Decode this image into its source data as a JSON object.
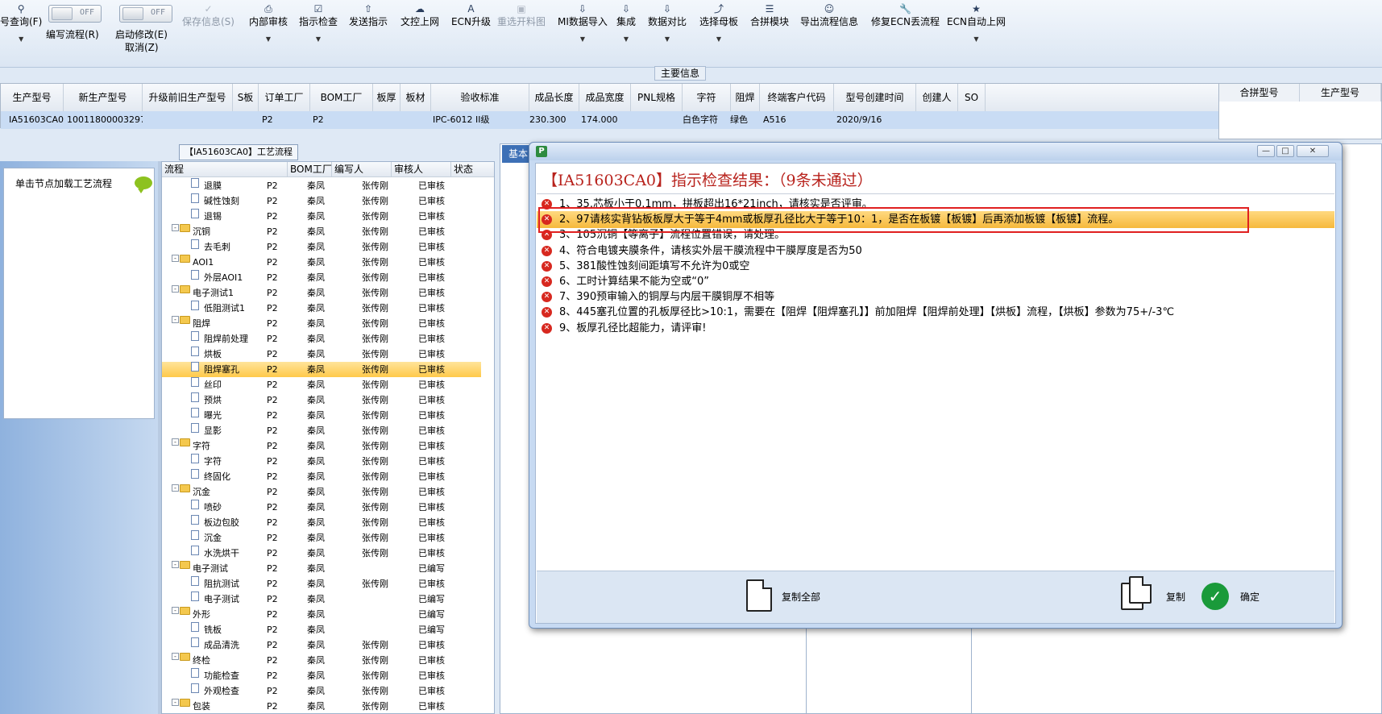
{
  "toolbar": {
    "query_label": "号查询(F)",
    "toggle1_state": "OFF",
    "toggle1_label": "编写流程(R)",
    "toggle2_state": "OFF",
    "toggle2_label": "启动修改(E)",
    "toggle2_sub": "取消(Z)",
    "items": [
      {
        "label": "保存信息(S)"
      },
      {
        "label": "内部审核"
      },
      {
        "label": "指示检查"
      },
      {
        "label": "发送指示"
      },
      {
        "label": "文控上网"
      },
      {
        "label": "ECN升级"
      },
      {
        "label": "重选开料图"
      },
      {
        "label": "MI数据导入"
      },
      {
        "label": "集成"
      },
      {
        "label": "数据对比"
      },
      {
        "label": "选择母板"
      },
      {
        "label": "合拼模块"
      },
      {
        "label": "导出流程信息"
      },
      {
        "label": "修复ECN丢流程"
      },
      {
        "label": "ECN自动上网"
      }
    ]
  },
  "section_label": "主要信息",
  "main_grid": {
    "headers": [
      "生产型号",
      "新生产型号",
      "升级前旧生产型号",
      "S板",
      "订单工厂",
      "BOM工厂",
      "板厚",
      "板材",
      "验收标准",
      "成品长度",
      "成品宽度",
      "PNL规格",
      "字符",
      "阻焊",
      "终端客户代码",
      "型号创建时间",
      "创建人",
      "SO"
    ],
    "row": [
      "IA51603CA0",
      "10011800003297",
      "",
      "",
      "P2",
      "P2",
      "",
      "",
      "IPC-6012 II级",
      "230.300",
      "174.000",
      "",
      "白色字符",
      "绿色",
      "A516",
      "2020/9/16",
      "",
      ""
    ]
  },
  "right_grid": {
    "headers": [
      "合拼型号",
      "生产型号"
    ]
  },
  "process_title": "【IA51603CA0】工艺流程",
  "left_panel": {
    "text": "单击节点加载工艺流程"
  },
  "tree": {
    "headers": [
      "流程",
      "BOM工厂",
      "编写人",
      "审核人",
      "状态"
    ],
    "rows": [
      {
        "name": "退膜",
        "type": "doc",
        "bom": "P2",
        "writer": "秦凤",
        "reviewer": "张传刚",
        "status": "已审核"
      },
      {
        "name": "碱性蚀刻",
        "type": "doc",
        "bom": "P2",
        "writer": "秦凤",
        "reviewer": "张传刚",
        "status": "已审核"
      },
      {
        "name": "退锡",
        "type": "doc",
        "bom": "P2",
        "writer": "秦凤",
        "reviewer": "张传刚",
        "status": "已审核"
      },
      {
        "name": "沉铜",
        "type": "folder",
        "bom": "P2",
        "writer": "秦凤",
        "reviewer": "张传刚",
        "status": "已审核"
      },
      {
        "name": "去毛刺",
        "type": "doc",
        "bom": "P2",
        "writer": "秦凤",
        "reviewer": "张传刚",
        "status": "已审核"
      },
      {
        "name": "AOI1",
        "type": "folder",
        "bom": "P2",
        "writer": "秦凤",
        "reviewer": "张传刚",
        "status": "已审核"
      },
      {
        "name": "外层AOI1",
        "type": "doc",
        "bom": "P2",
        "writer": "秦凤",
        "reviewer": "张传刚",
        "status": "已审核"
      },
      {
        "name": "电子测试1",
        "type": "folder",
        "bom": "P2",
        "writer": "秦凤",
        "reviewer": "张传刚",
        "status": "已审核"
      },
      {
        "name": "低阻测试1",
        "type": "doc",
        "bom": "P2",
        "writer": "秦凤",
        "reviewer": "张传刚",
        "status": "已审核"
      },
      {
        "name": "阻焊",
        "type": "folder",
        "bom": "P2",
        "writer": "秦凤",
        "reviewer": "张传刚",
        "status": "已审核"
      },
      {
        "name": "阻焊前处理",
        "type": "doc",
        "bom": "P2",
        "writer": "秦凤",
        "reviewer": "张传刚",
        "status": "已审核"
      },
      {
        "name": "烘板",
        "type": "doc",
        "bom": "P2",
        "writer": "秦凤",
        "reviewer": "张传刚",
        "status": "已审核"
      },
      {
        "name": "阻焊塞孔",
        "type": "doc",
        "bom": "P2",
        "writer": "秦凤",
        "reviewer": "张传刚",
        "status": "已审核",
        "selected": true
      },
      {
        "name": "丝印",
        "type": "doc",
        "bom": "P2",
        "writer": "秦凤",
        "reviewer": "张传刚",
        "status": "已审核"
      },
      {
        "name": "预烘",
        "type": "doc",
        "bom": "P2",
        "writer": "秦凤",
        "reviewer": "张传刚",
        "status": "已审核"
      },
      {
        "name": "曝光",
        "type": "doc",
        "bom": "P2",
        "writer": "秦凤",
        "reviewer": "张传刚",
        "status": "已审核"
      },
      {
        "name": "显影",
        "type": "doc",
        "bom": "P2",
        "writer": "秦凤",
        "reviewer": "张传刚",
        "status": "已审核"
      },
      {
        "name": "字符",
        "type": "folder",
        "bom": "P2",
        "writer": "秦凤",
        "reviewer": "张传刚",
        "status": "已审核"
      },
      {
        "name": "字符",
        "type": "doc",
        "bom": "P2",
        "writer": "秦凤",
        "reviewer": "张传刚",
        "status": "已审核"
      },
      {
        "name": "终固化",
        "type": "doc",
        "bom": "P2",
        "writer": "秦凤",
        "reviewer": "张传刚",
        "status": "已审核"
      },
      {
        "name": "沉金",
        "type": "folder",
        "bom": "P2",
        "writer": "秦凤",
        "reviewer": "张传刚",
        "status": "已审核"
      },
      {
        "name": "喷砂",
        "type": "doc",
        "bom": "P2",
        "writer": "秦凤",
        "reviewer": "张传刚",
        "status": "已审核"
      },
      {
        "name": "板边包胶",
        "type": "doc",
        "bom": "P2",
        "writer": "秦凤",
        "reviewer": "张传刚",
        "status": "已审核"
      },
      {
        "name": "沉金",
        "type": "doc",
        "bom": "P2",
        "writer": "秦凤",
        "reviewer": "张传刚",
        "status": "已审核"
      },
      {
        "name": "水洗烘干",
        "type": "doc",
        "bom": "P2",
        "writer": "秦凤",
        "reviewer": "张传刚",
        "status": "已审核"
      },
      {
        "name": "电子测试",
        "type": "folder",
        "bom": "P2",
        "writer": "秦凤",
        "reviewer": "",
        "status": "已编写"
      },
      {
        "name": "阻抗测试",
        "type": "doc",
        "bom": "P2",
        "writer": "秦凤",
        "reviewer": "张传刚",
        "status": "已审核"
      },
      {
        "name": "电子测试",
        "type": "doc",
        "bom": "P2",
        "writer": "秦凤",
        "reviewer": "",
        "status": "已编写"
      },
      {
        "name": "外形",
        "type": "folder",
        "bom": "P2",
        "writer": "秦凤",
        "reviewer": "",
        "status": "已编写"
      },
      {
        "name": "铣板",
        "type": "doc",
        "bom": "P2",
        "writer": "秦凤",
        "reviewer": "",
        "status": "已编写"
      },
      {
        "name": "成品清洗",
        "type": "doc",
        "bom": "P2",
        "writer": "秦凤",
        "reviewer": "张传刚",
        "status": "已审核"
      },
      {
        "name": "终检",
        "type": "folder",
        "bom": "P2",
        "writer": "秦凤",
        "reviewer": "张传刚",
        "status": "已审核"
      },
      {
        "name": "功能检查",
        "type": "doc",
        "bom": "P2",
        "writer": "秦凤",
        "reviewer": "张传刚",
        "status": "已审核"
      },
      {
        "name": "外观检查",
        "type": "doc",
        "bom": "P2",
        "writer": "秦凤",
        "reviewer": "张传刚",
        "status": "已审核"
      },
      {
        "name": "包装",
        "type": "folder",
        "bom": "P2",
        "writer": "秦凤",
        "reviewer": "张传刚",
        "status": "已审核"
      }
    ]
  },
  "bg_tab": "基本",
  "dialog": {
    "heading": "【IA51603CA0】指示检查结果：（9条未通过）",
    "items": [
      "1、35.芯板小于0.1mm，拼板超出16*21inch，请核实是否评审。",
      "2、97请核实背钻板板厚大于等于4mm或板厚孔径比大于等于10：1，是否在板镀【板镀】后再添加板镀【板镀】流程。",
      "3、105沉铜【等离子】流程位置错误，请处理。",
      "4、符合电镀夹膜条件，请核实外层干膜流程中干膜厚度是否为50",
      "5、381酸性蚀刻间距填写不允许为0或空",
      "6、工时计算结果不能为空或“0”",
      "7、390预审输入的铜厚与内层干膜铜厚不相等",
      "8、445塞孔位置的孔板厚径比>10:1，需要在【阻焊【阻焊塞孔】】前加阻焊【阻焊前处理】【烘板】流程，【烘板】参数为75+/-3℃",
      "9、板厚孔径比超能力，请评审!"
    ],
    "selected_index": 1,
    "copy_all_label": "复制全部",
    "copy_label": "复制",
    "ok_label": "确定",
    "colors": {
      "heading": "#b8221c",
      "error": "#d7281f",
      "highlight": "#e02020",
      "ok": "#1a9a3a"
    }
  }
}
